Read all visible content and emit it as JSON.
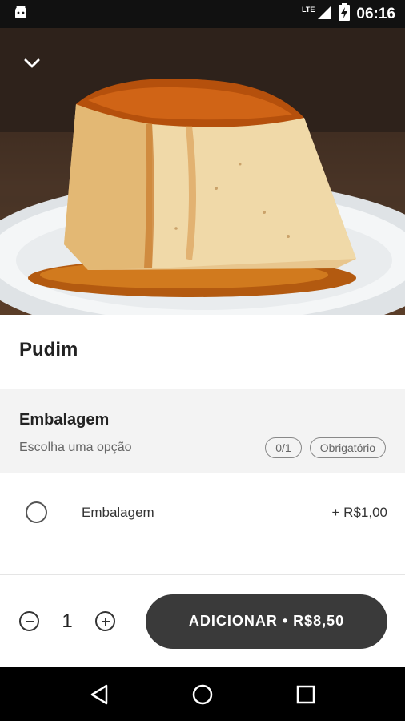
{
  "status_bar": {
    "time": "06:16",
    "network": "LTE",
    "icons": [
      "android-debug-icon",
      "signal-icon",
      "battery-charging-icon"
    ]
  },
  "product": {
    "title": "Pudim",
    "image_description_icon": "pudim-photo"
  },
  "group": {
    "title": "Embalagem",
    "subtitle": "Escolha uma opção",
    "count_badge": "0/1",
    "required_badge": "Obrigatório"
  },
  "options": [
    {
      "label": "Embalagem",
      "price": "+ R$1,00",
      "selected": false
    }
  ],
  "cart": {
    "quantity": "1",
    "add_button_label": "ADICIONAR • R$8,50"
  },
  "colors": {
    "button_bg": "#3a3a3a",
    "section_bg": "#f3f3f3",
    "caramel": "#c46a16"
  }
}
